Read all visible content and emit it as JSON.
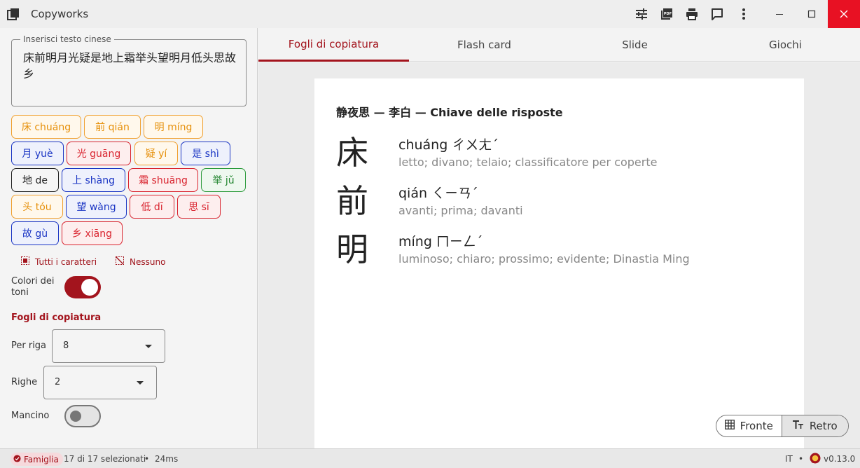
{
  "window": {
    "title": "Copyworks",
    "toolbar_icons": [
      "sliders-icon",
      "pdf-icon",
      "print-icon",
      "feedback-icon",
      "more-vert-icon"
    ],
    "controls": [
      "minimize-icon",
      "maximize-icon",
      "close-icon"
    ]
  },
  "input": {
    "legend": "Inserisci testo cinese",
    "value": "床前明月光疑是地上霜举头望明月低头思故乡"
  },
  "chips": [
    {
      "label": "床 chuáng",
      "tone": "orange"
    },
    {
      "label": "前 qián",
      "tone": "orange"
    },
    {
      "label": "明 míng",
      "tone": "orange"
    },
    {
      "label": "月 yuè",
      "tone": "blue"
    },
    {
      "label": "光 guāng",
      "tone": "red"
    },
    {
      "label": "疑 yí",
      "tone": "orange"
    },
    {
      "label": "是 shì",
      "tone": "blue"
    },
    {
      "label": "地 de",
      "tone": "black"
    },
    {
      "label": "上 shàng",
      "tone": "blue"
    },
    {
      "label": "霜 shuāng",
      "tone": "red"
    },
    {
      "label": "举 jǔ",
      "tone": "green"
    },
    {
      "label": "头 tóu",
      "tone": "orange"
    },
    {
      "label": "望 wàng",
      "tone": "blue"
    },
    {
      "label": "低 dī",
      "tone": "red"
    },
    {
      "label": "思 sī",
      "tone": "red"
    },
    {
      "label": "故 gù",
      "tone": "blue"
    },
    {
      "label": "乡 xiāng",
      "tone": "red"
    }
  ],
  "selection": {
    "all": "Tutti i caratteri",
    "none": "Nessuno"
  },
  "tone_colors": {
    "label": "Colori dei toni",
    "enabled": true
  },
  "sheets": {
    "section": "Fogli di copiatura",
    "per_row_label": "Per riga",
    "per_row_value": "8",
    "rows_label": "Righe",
    "rows_value": "2",
    "left_handed_label": "Mancino",
    "left_handed": false
  },
  "tabs": [
    "Fogli di copiatura",
    "Flash card",
    "Slide",
    "Giochi"
  ],
  "active_tab": "Fogli di copiatura",
  "sheet": {
    "title": "静夜思 — 李白 — Chiave delle risposte",
    "entries": [
      {
        "hanzi": "床",
        "pinyin": "chuáng ㄔㄨㄤˊ",
        "meaning": "letto; divano; telaio; classificatore per coperte"
      },
      {
        "hanzi": "前",
        "pinyin": "qián ㄑㄧㄢˊ",
        "meaning": "avanti; prima; davanti"
      },
      {
        "hanzi": "明",
        "pinyin": "míng ㄇㄧㄥˊ",
        "meaning": "luminoso; chiaro; prossimo; evidente; Dinastia Ming"
      }
    ]
  },
  "side_toggle": {
    "front": "Fronte",
    "back": "Retro",
    "selected": "Retro"
  },
  "status": {
    "badge": "Famiglia",
    "selected": "17 di 17 selezionati",
    "separator": "•",
    "timing": "24ms",
    "lang": "IT",
    "version": "v0.13.0"
  },
  "colors": {
    "accent": "#a3141d",
    "tone_orange": "#e6900a",
    "tone_blue": "#1a35c4",
    "tone_red": "#d9242f",
    "tone_black": "#222222",
    "tone_green": "#22862f"
  }
}
